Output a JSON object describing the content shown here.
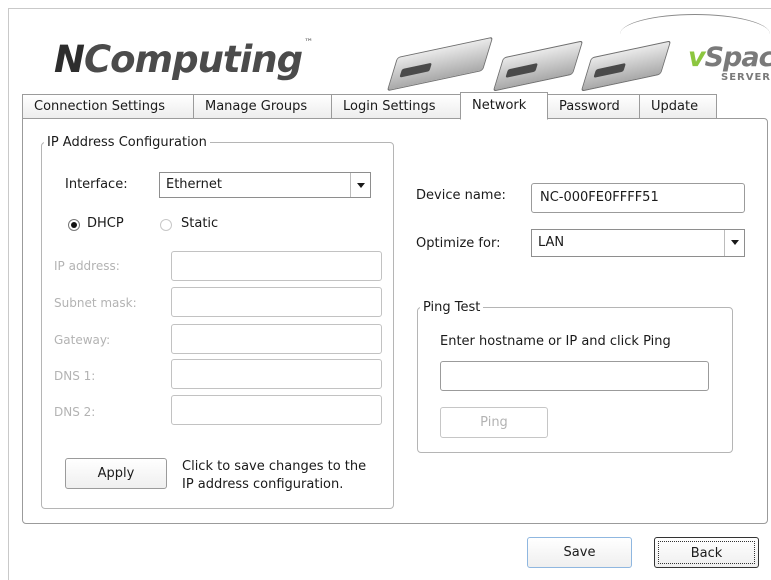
{
  "header": {
    "logo_n": "N",
    "logo_text": "Computing",
    "logo_tm": "™",
    "vspace_v": "v",
    "vspace_text": "Space",
    "vspace_tm": "™",
    "server_label": "SERVER"
  },
  "tabs": [
    {
      "label": "Connection Settings",
      "active": false
    },
    {
      "label": "Manage Groups",
      "active": false
    },
    {
      "label": "Login Settings",
      "active": false
    },
    {
      "label": "Network",
      "active": true
    },
    {
      "label": "Password",
      "active": false
    },
    {
      "label": "Update",
      "active": false
    }
  ],
  "ip_config": {
    "legend": "IP Address Configuration",
    "interface_label": "Interface:",
    "interface_value": "Ethernet",
    "dhcp_label": "DHCP",
    "static_label": "Static",
    "selected_mode": "DHCP",
    "ip_address_label": "IP address:",
    "subnet_mask_label": "Subnet mask:",
    "gateway_label": "Gateway:",
    "dns1_label": "DNS 1:",
    "dns2_label": "DNS 2:",
    "ip_address_value": "",
    "subnet_mask_value": "",
    "gateway_value": "",
    "dns1_value": "",
    "dns2_value": "",
    "apply_label": "Apply",
    "apply_note_line1": "Click to save changes to the",
    "apply_note_line2": "IP address configuration."
  },
  "device": {
    "name_label": "Device name:",
    "name_value": "NC-000FE0FFFF51",
    "optimize_label": "Optimize for:",
    "optimize_value": "LAN"
  },
  "ping": {
    "legend": "Ping Test",
    "instruction": "Enter hostname or IP and click Ping",
    "host_value": "",
    "ping_label": "Ping"
  },
  "footer": {
    "save_label": "Save",
    "back_label": "Back"
  }
}
